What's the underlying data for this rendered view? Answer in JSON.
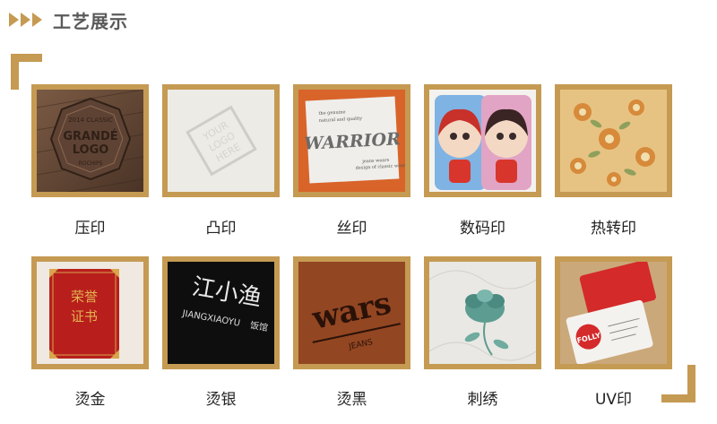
{
  "section": {
    "title": "工艺展示"
  },
  "items": [
    {
      "label": "压印",
      "icon": "embossed-leather-logo-icon"
    },
    {
      "label": "凸印",
      "icon": "raised-logo-paper-icon"
    },
    {
      "label": "丝印",
      "icon": "silk-print-label-icon"
    },
    {
      "label": "数码印",
      "icon": "digital-print-cartoon-icon"
    },
    {
      "label": "热转印",
      "icon": "heat-transfer-floral-icon"
    },
    {
      "label": "烫金",
      "icon": "gold-foil-certificate-icon"
    },
    {
      "label": "烫银",
      "icon": "silver-foil-text-icon"
    },
    {
      "label": "烫黑",
      "icon": "black-foil-leather-icon"
    },
    {
      "label": "刺绣",
      "icon": "embroidery-flower-icon"
    },
    {
      "label": "UV印",
      "icon": "uv-print-card-icon"
    }
  ],
  "images": {
    "emboss_top": "2014 CLASSIC",
    "emboss_line1": "GRANDÉ",
    "emboss_line2": "LOGO",
    "emboss_bottom": "ROCHIPS",
    "raised_line1": "YOUR",
    "raised_line2": "LOGO",
    "raised_line3": "HERE",
    "label_top1": "the genuine",
    "label_top2": "natural and quality",
    "label_main": "WARRIOR",
    "label_sub1": "jeans wears",
    "label_sub2": "design of classic wears",
    "silver_cn": "江小渔",
    "silver_en": "JIANGXIAOYU",
    "silver_tail": "饭馆",
    "black_text": "wars",
    "black_sub": "JEANS",
    "cert_l1": "荣誉",
    "cert_l2": "证书",
    "uv_brand": "FOLLY"
  }
}
